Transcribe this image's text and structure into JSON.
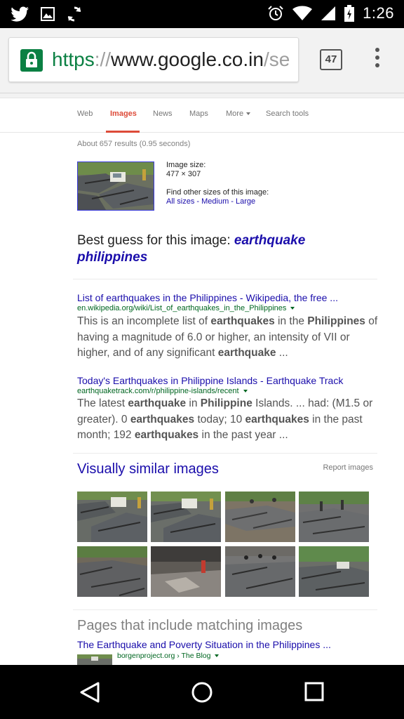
{
  "status_bar": {
    "time": "1:26",
    "left_icons": [
      "twitter-icon",
      "gallery-icon",
      "sync-icon"
    ],
    "right_icons": [
      "alarm-icon",
      "wifi-icon",
      "signal-icon",
      "battery-charging-icon"
    ]
  },
  "browser": {
    "url_scheme": "https",
    "url_sep": "://",
    "url_host": "www.google.co.in",
    "url_path": "/se",
    "tab_count": "47"
  },
  "tabs": [
    {
      "label": "Web",
      "active": false
    },
    {
      "label": "Images",
      "active": true
    },
    {
      "label": "News",
      "active": false
    },
    {
      "label": "Maps",
      "active": false
    },
    {
      "label": "More",
      "active": false
    },
    {
      "label": "Search tools",
      "active": false
    }
  ],
  "results_stats": "About 657 results (0.95 seconds)",
  "image_info": {
    "size_label": "Image size:",
    "size_value": "477 × 307",
    "other_sizes_label": "Find other sizes of this image:",
    "sizes": [
      "All sizes",
      "Medium",
      "Large"
    ],
    "sizes_sep": " - "
  },
  "best_guess": {
    "prefix": "Best guess for this image: ",
    "query": "earthquake philippines"
  },
  "results": [
    {
      "title": "List of earthquakes in the Philippines - Wikipedia, the free ...",
      "url": "en.wikipedia.org/wiki/List_of_earthquakes_in_the_Philippines",
      "snippet": [
        {
          "t": "This is an incomplete list of ",
          "b": false
        },
        {
          "t": "earthquakes",
          "b": true
        },
        {
          "t": " in the ",
          "b": false
        },
        {
          "t": "Philippines",
          "b": true
        },
        {
          "t": " of having a magnitude of 6.0 or higher, an intensity of VII or higher, and of any significant ",
          "b": false
        },
        {
          "t": "earthquake",
          "b": true
        },
        {
          "t": " ...",
          "b": false
        }
      ]
    },
    {
      "title": "Today's Earthquakes in Philippine Islands - Earthquake Track",
      "url": "earthquaketrack.com/r/philippine-islands/recent",
      "snippet": [
        {
          "t": "The latest ",
          "b": false
        },
        {
          "t": "earthquake",
          "b": true
        },
        {
          "t": " in ",
          "b": false
        },
        {
          "t": "Philippine",
          "b": true
        },
        {
          "t": " Islands. ... had: (M1.5 or greater). 0 ",
          "b": false
        },
        {
          "t": "earthquakes",
          "b": true
        },
        {
          "t": " today; 10 ",
          "b": false
        },
        {
          "t": "earthquakes",
          "b": true
        },
        {
          "t": " in the past month; 192 ",
          "b": false
        },
        {
          "t": "earthquakes",
          "b": true
        },
        {
          "t": " in the past year ...",
          "b": false
        }
      ]
    }
  ],
  "visually_similar": {
    "title": "Visually similar images",
    "report_label": "Report images",
    "image_count": 8
  },
  "pages_section": {
    "title": "Pages that include matching images",
    "result_title": "The Earthquake and Poverty Situation in the Philippines ...",
    "result_url": "borgenproject.org › The Blog"
  },
  "colors": {
    "link": "#1a0dab",
    "url_green": "#006621",
    "active_tab": "#dd4b39",
    "secure_green": "#0b8043"
  }
}
